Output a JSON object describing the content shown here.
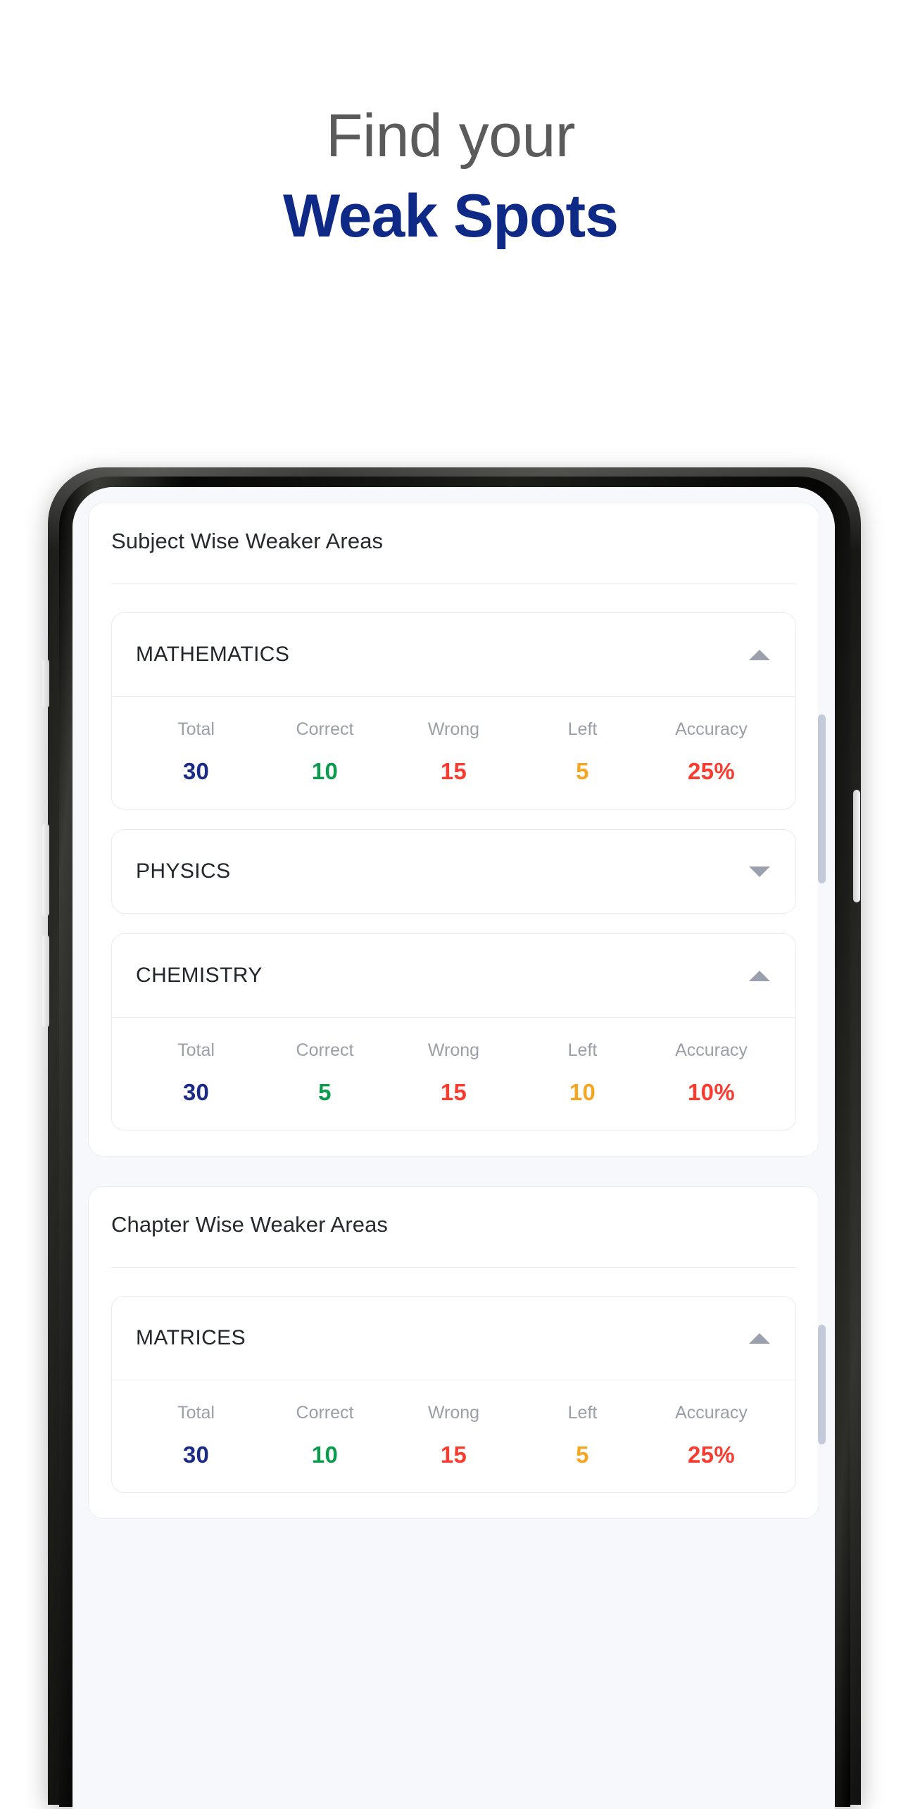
{
  "headline": {
    "line1": "Find your",
    "line2": "Weak Spots",
    "line1_color": "#5b5b5b",
    "line2_color": "#0f2a86"
  },
  "colors": {
    "total": "#1b2a86",
    "correct": "#0a9b4d",
    "wrong": "#fa3b30",
    "left": "#f5a623",
    "accuracy": "#fa3b30",
    "label": "#9a9fa8",
    "screen_bg": "#f7f8fb",
    "scrollbar": "#c3cada"
  },
  "stat_headers": [
    "Total",
    "Correct",
    "Wrong",
    "Left",
    "Accuracy"
  ],
  "icons": {
    "expanded": "triangle-up-icon",
    "collapsed": "triangle-down-icon"
  },
  "panels": [
    {
      "title": "Subject Wise Weaker Areas",
      "items": [
        {
          "name": "MATHEMATICS",
          "expanded": true,
          "stats": {
            "total": "30",
            "correct": "10",
            "wrong": "15",
            "left": "5",
            "accuracy": "25%"
          }
        },
        {
          "name": "PHYSICS",
          "expanded": false,
          "stats": null
        },
        {
          "name": "CHEMISTRY",
          "expanded": true,
          "stats": {
            "total": "30",
            "correct": "5",
            "wrong": "15",
            "left": "10",
            "accuracy": "10%"
          }
        }
      ]
    },
    {
      "title": "Chapter Wise Weaker Areas",
      "items": [
        {
          "name": "MATRICES",
          "expanded": true,
          "stats": {
            "total": "30",
            "correct": "10",
            "wrong": "15",
            "left": "5",
            "accuracy": "25%"
          }
        }
      ]
    }
  ]
}
